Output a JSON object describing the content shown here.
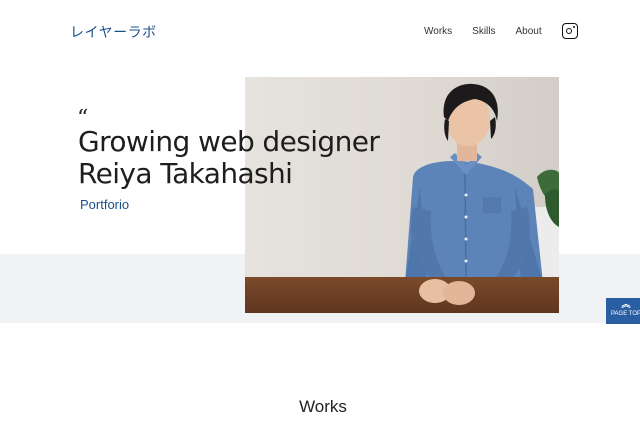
{
  "header": {
    "logo": "レイヤーラボ",
    "nav": [
      "Works",
      "Skills",
      "About"
    ],
    "instagram_icon": "instagram-icon"
  },
  "hero": {
    "quote": "“",
    "title_line1": "Growing web designer",
    "title_line2": "Reiya Takahashi",
    "subtitle": "Portforio"
  },
  "page_top": {
    "icon": "double-chevron-up-icon",
    "label": "PAGE TOP"
  },
  "sections": {
    "works_heading": "Works"
  },
  "colors": {
    "accent": "#1a4f8b",
    "page_top_bg": "#2a5ea3",
    "band": "#f1f2f4"
  }
}
